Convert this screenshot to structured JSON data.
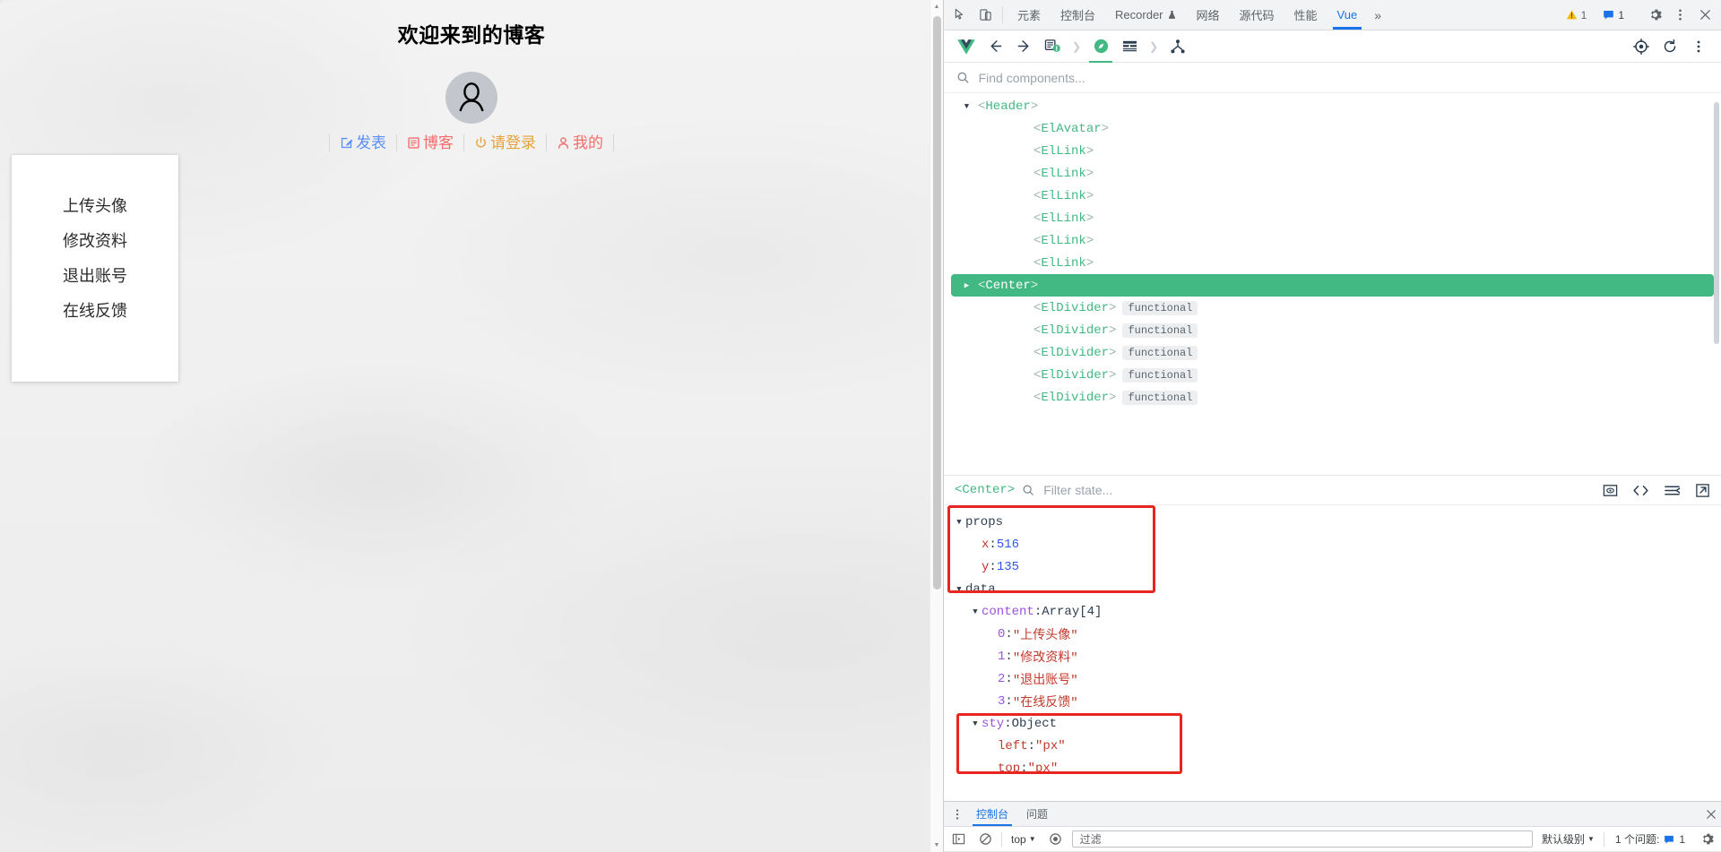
{
  "webpage": {
    "title": "欢迎来到的博客",
    "avatar_icon": "user-avatar-icon",
    "nav": [
      {
        "label": "发表",
        "icon": "edit-square-icon",
        "color": "#5b8ff9"
      },
      {
        "label": "博客",
        "icon": "document-icon",
        "color": "#f56c6c"
      },
      {
        "label": "请登录",
        "icon": "power-switch-icon",
        "color": "#e6a23c"
      },
      {
        "label": "我的",
        "icon": "user-icon",
        "color": "#f56c6c"
      }
    ],
    "menu_items": [
      "上传头像",
      "修改资料",
      "退出账号",
      "在线反馈"
    ]
  },
  "devtools": {
    "toolbar": {
      "inspect_icon": "inspect-element-icon",
      "device_icon": "device-toolbar-icon",
      "tabs": [
        {
          "label": "元素",
          "active": false
        },
        {
          "label": "控制台",
          "active": false
        },
        {
          "label": "Recorder",
          "active": false,
          "suffix_icon": "flask-icon"
        },
        {
          "label": "网络",
          "active": false
        },
        {
          "label": "源代码",
          "active": false
        },
        {
          "label": "性能",
          "active": false
        },
        {
          "label": "Vue",
          "active": true
        }
      ],
      "overflow_icon": "chevron-double-right-icon",
      "warning_count": "1",
      "message_count": "1",
      "settings_icon": "gear-icon",
      "more_icon": "kebab-menu-icon",
      "close_icon": "close-icon"
    },
    "vue_toolbar": {
      "logo_icon": "vue-logo-icon",
      "back_icon": "arrow-left-icon",
      "forward_icon": "arrow-right-icon",
      "components_icon": "components-icon",
      "vuex_icon": "vuex-compass-icon",
      "events_icon": "events-icon",
      "routes_icon": "routes-tree-icon",
      "target_icon": "select-target-icon",
      "refresh_icon": "refresh-icon",
      "more_icon": "kebab-menu-icon"
    },
    "find": {
      "icon": "search-icon",
      "placeholder": "Find components...",
      "value": ""
    },
    "tree": [
      {
        "tag": "Header",
        "indent": 1,
        "caret": "down",
        "flag": "",
        "selected": false
      },
      {
        "tag": "ElAvatar",
        "indent": 2,
        "caret": "",
        "flag": "",
        "selected": false
      },
      {
        "tag": "ElLink",
        "indent": 2,
        "caret": "",
        "flag": "",
        "selected": false
      },
      {
        "tag": "ElLink",
        "indent": 2,
        "caret": "",
        "flag": "",
        "selected": false
      },
      {
        "tag": "ElLink",
        "indent": 2,
        "caret": "",
        "flag": "",
        "selected": false
      },
      {
        "tag": "ElLink",
        "indent": 2,
        "caret": "",
        "flag": "",
        "selected": false
      },
      {
        "tag": "ElLink",
        "indent": 2,
        "caret": "",
        "flag": "",
        "selected": false
      },
      {
        "tag": "ElLink",
        "indent": 2,
        "caret": "",
        "flag": "",
        "selected": false
      },
      {
        "tag": "Center",
        "indent": 1,
        "caret": "right",
        "flag": "",
        "selected": true
      },
      {
        "tag": "ElDivider",
        "indent": 2,
        "caret": "",
        "flag": "functional",
        "selected": false
      },
      {
        "tag": "ElDivider",
        "indent": 2,
        "caret": "",
        "flag": "functional",
        "selected": false
      },
      {
        "tag": "ElDivider",
        "indent": 2,
        "caret": "",
        "flag": "functional",
        "selected": false
      },
      {
        "tag": "ElDivider",
        "indent": 2,
        "caret": "",
        "flag": "functional",
        "selected": false
      },
      {
        "tag": "ElDivider",
        "indent": 2,
        "caret": "",
        "flag": "functional",
        "selected": false
      }
    ],
    "inspector": {
      "component_name": "<Center>",
      "search_icon": "search-icon",
      "filter_placeholder": "Filter state...",
      "filter_value": "",
      "actions": [
        {
          "icon": "scroll-into-view-icon"
        },
        {
          "icon": "open-in-editor-icon"
        },
        {
          "icon": "collapse-all-icon"
        },
        {
          "icon": "open-external-icon"
        }
      ],
      "state": {
        "props_label": "props",
        "props": [
          {
            "key": "x",
            "value": "516",
            "type": "number"
          },
          {
            "key": "y",
            "value": "135",
            "type": "number"
          }
        ],
        "data_label": "data",
        "content_key": "content",
        "content_type": "Array[4]",
        "content_items": [
          {
            "index": "0",
            "value": "\"上传头像\""
          },
          {
            "index": "1",
            "value": "\"修改资料\""
          },
          {
            "index": "2",
            "value": "\"退出账号\""
          },
          {
            "index": "3",
            "value": "\"在线反馈\""
          }
        ],
        "sty_key": "sty",
        "sty_type": "Object",
        "sty_items": [
          {
            "key": "left",
            "value": "\"px\""
          },
          {
            "key": "top",
            "value": "\"px\""
          }
        ]
      }
    },
    "drawer": {
      "more_icon": "kebab-menu-icon",
      "tabs": [
        {
          "label": "控制台",
          "active": true
        },
        {
          "label": "问题",
          "active": false
        }
      ],
      "close_icon": "close-icon",
      "console": {
        "sidebar_icon": "console-sidebar-icon",
        "clear_icon": "clear-console-icon",
        "context": "top",
        "eye_icon": "live-expression-icon",
        "filter_placeholder": "过滤",
        "filter_value": "",
        "level": "默认级别",
        "issues_text": "1 个问题:",
        "issues_count": "1",
        "settings_icon": "gear-icon"
      }
    }
  },
  "colors": {
    "vue_green": "#42b883",
    "chrome_blue": "#1a73e8",
    "highlight_red": "#e8251f"
  }
}
